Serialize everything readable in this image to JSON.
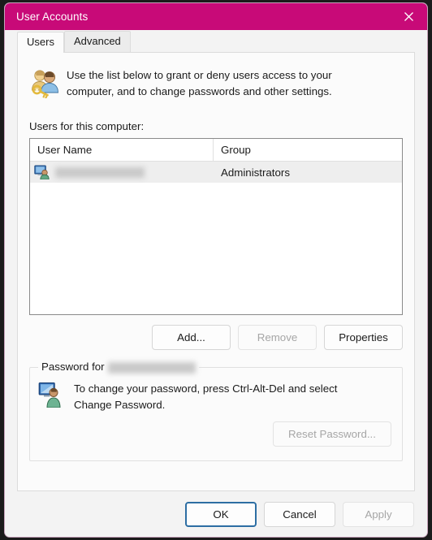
{
  "window": {
    "title": "User Accounts",
    "accent_color": "#c80a78",
    "close_icon": "close-icon"
  },
  "tabs": [
    {
      "label": "Users",
      "active": true
    },
    {
      "label": "Advanced",
      "active": false
    }
  ],
  "description": {
    "icon": "users-key-icon",
    "line1": "Use the list below to grant or deny users access to your",
    "line2": "computer, and to change passwords and other settings."
  },
  "users_section": {
    "label": "Users for this computer:",
    "columns": [
      "User Name",
      "Group"
    ],
    "rows": [
      {
        "icon": "user-account-icon",
        "user_name": "",
        "user_name_redacted": true,
        "group": "Administrators",
        "selected": true
      }
    ],
    "buttons": [
      {
        "label": "Add...",
        "enabled": true
      },
      {
        "label": "Remove",
        "enabled": false
      },
      {
        "label": "Properties",
        "enabled": true
      }
    ]
  },
  "password_section": {
    "title_prefix": "Password for",
    "title_name_redacted": true,
    "icon": "user-monitor-icon",
    "line1": "To change your password, press Ctrl-Alt-Del and select",
    "line2": "Change Password.",
    "buttons": [
      {
        "label": "Reset Password...",
        "enabled": false
      }
    ]
  },
  "dialog_buttons": [
    {
      "label": "OK",
      "enabled": true,
      "default": true
    },
    {
      "label": "Cancel",
      "enabled": true,
      "default": false
    },
    {
      "label": "Apply",
      "enabled": false,
      "default": false
    }
  ]
}
